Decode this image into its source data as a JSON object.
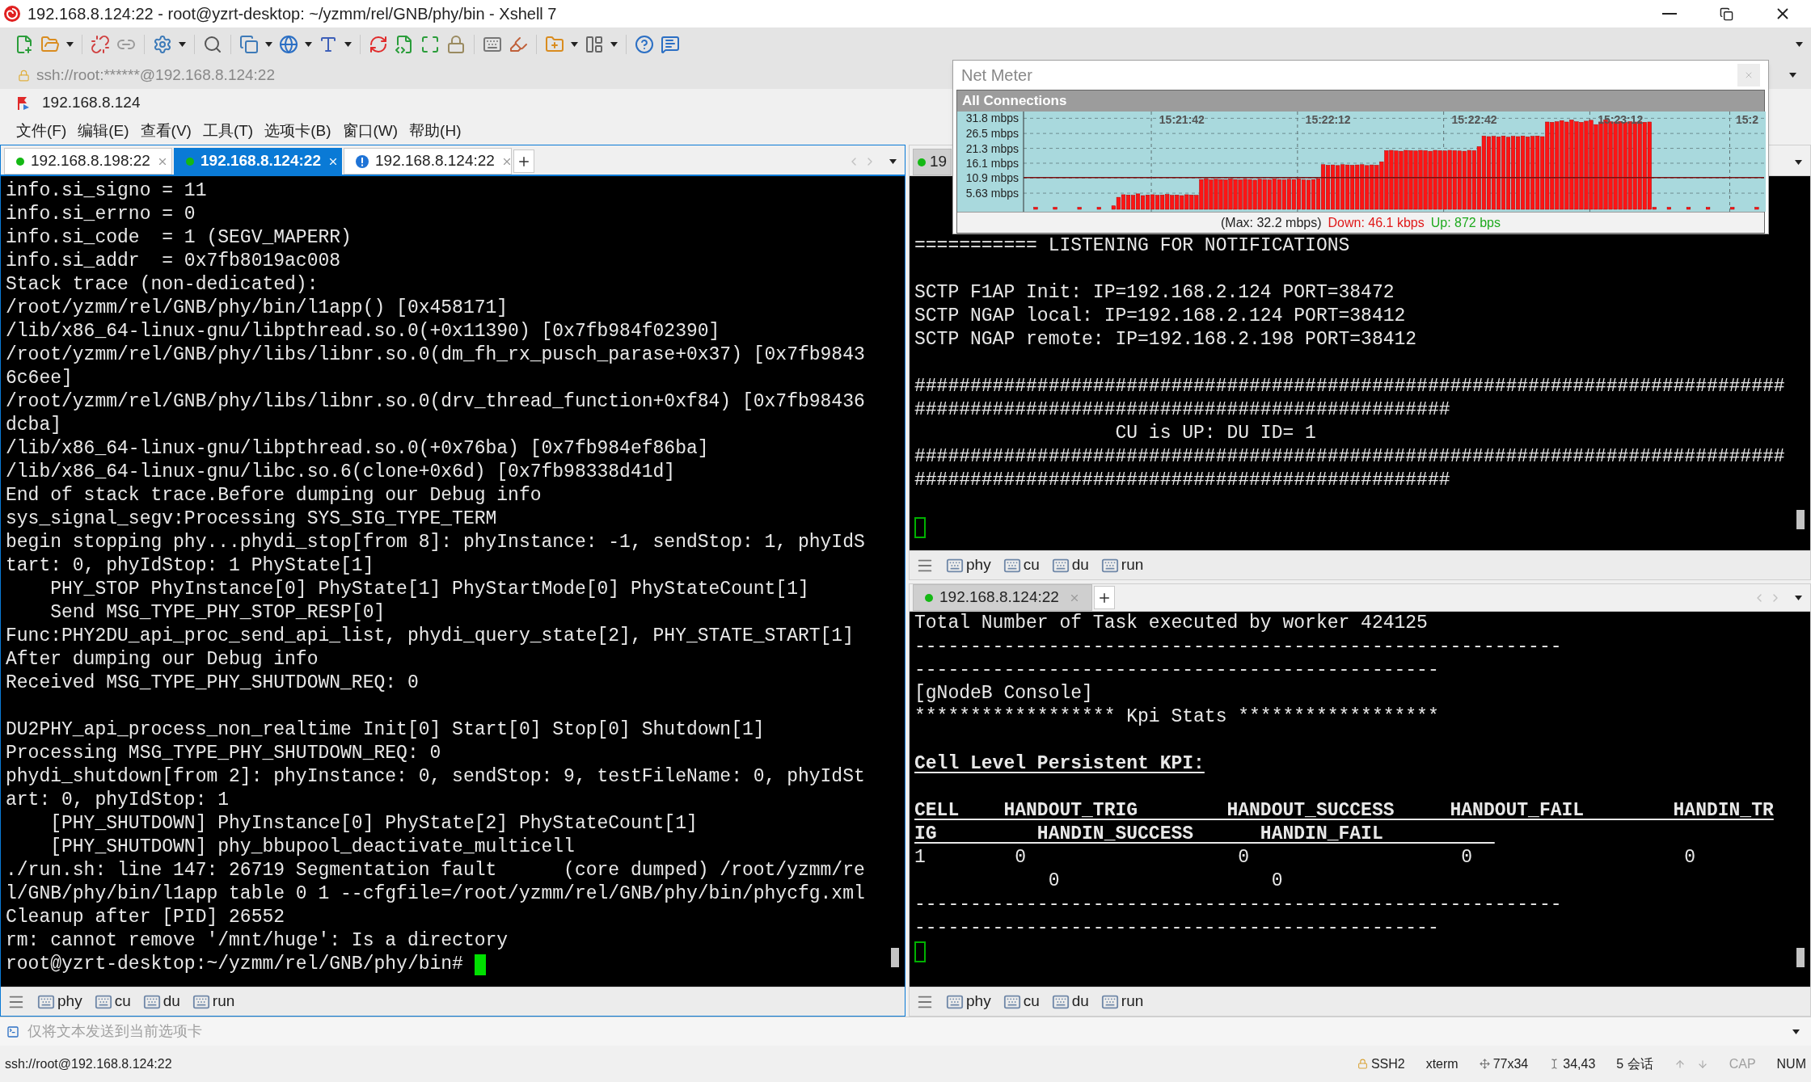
{
  "window": {
    "title": "192.168.8.124:22 - root@yzrt-desktop: ~/yzmm/rel/GNB/phy/bin - Xshell 7"
  },
  "address_bar": {
    "value": "ssh://root:******@192.168.8.124:22"
  },
  "session_bar": {
    "label": "192.168.8.124"
  },
  "menu": [
    "文件(F)",
    "编辑(E)",
    "查看(V)",
    "工具(T)",
    "选项卡(B)",
    "窗口(W)",
    "帮助(H)"
  ],
  "panes": [
    {
      "active": true,
      "tabs": [
        {
          "label": "192.168.8.198:22",
          "kind": "connected",
          "selected": false,
          "closable": true
        },
        {
          "label": "192.168.8.124:22",
          "kind": "connected",
          "selected": true,
          "closable": true
        },
        {
          "label": "192.168.8.124:22",
          "kind": "alert",
          "selected": false,
          "closable": true
        }
      ],
      "terminal": {
        "cursor_active": true,
        "prompt": "root@yzrt-desktop:~/yzmm/rel/GNB/phy/bin#",
        "lines": [
          {
            "kind": "text",
            "text": "info.si_signo = 11"
          },
          {
            "kind": "text",
            "text": "info.si_errno = 0"
          },
          {
            "kind": "text",
            "text": "info.si_code  = 1 (SEGV_MAPERR)"
          },
          {
            "kind": "text",
            "text": "info.si_addr  = 0x7fb8019ac008"
          },
          {
            "kind": "text",
            "text": "Stack trace (non-dedicated):"
          },
          {
            "kind": "text",
            "text": "/root/yzmm/rel/GNB/phy/bin/l1app() [0x458171]"
          },
          {
            "kind": "text",
            "text": "/lib/x86_64-linux-gnu/libpthread.so.0(+0x11390) [0x7fb984f02390]"
          },
          {
            "kind": "text",
            "text": "/root/yzmm/rel/GNB/phy/libs/libnr.so.0(dm_fh_rx_pusch_parase+0x37) [0x7fb9843"
          },
          {
            "kind": "text",
            "text": "6c6ee]"
          },
          {
            "kind": "text",
            "text": "/root/yzmm/rel/GNB/phy/libs/libnr.so.0(drv_thread_function+0xf84) [0x7fb98436"
          },
          {
            "kind": "text",
            "text": "dcba]"
          },
          {
            "kind": "text",
            "text": "/lib/x86_64-linux-gnu/libpthread.so.0(+0x76ba) [0x7fb984ef86ba]"
          },
          {
            "kind": "text",
            "text": "/lib/x86_64-linux-gnu/libc.so.6(clone+0x6d) [0x7fb98338d41d]"
          },
          {
            "kind": "text",
            "text": "End of stack trace.Before dumping our Debug info"
          },
          {
            "kind": "text",
            "text": "sys_signal_segv:Processing SYS_SIG_TYPE_TERM"
          },
          {
            "kind": "text",
            "text": "begin stopping phy...phydi_stop[from 8]: phyInstance: -1, sendStop: 1, phyIdS"
          },
          {
            "kind": "text",
            "text": "tart: 0, phyIdStop: 1 PhyState[1]"
          },
          {
            "kind": "text",
            "text": "    PHY_STOP PhyInstance[0] PhyState[1] PhyStartMode[0] PhyStateCount[1]"
          },
          {
            "kind": "text",
            "text": "    Send MSG_TYPE_PHY_STOP_RESP[0]"
          },
          {
            "kind": "text",
            "text": "Func:PHY2DU_api_proc_send_api_list, phydi_query_state[2], PHY_STATE_START[1]"
          },
          {
            "kind": "text",
            "text": "After dumping our Debug info"
          },
          {
            "kind": "text",
            "text": "Received MSG_TYPE_PHY_SHUTDOWN_REQ: 0"
          },
          {
            "kind": "blank"
          },
          {
            "kind": "text",
            "text": "DU2PHY_api_process_non_realtime Init[0] Start[0] Stop[0] Shutdown[1]"
          },
          {
            "kind": "text",
            "text": "Processing MSG_TYPE_PHY_SHUTDOWN_REQ: 0"
          },
          {
            "kind": "text",
            "text": "phydi_shutdown[from 2]: phyInstance: 0, sendStop: 9, testFileName: 0, phyIdSt"
          },
          {
            "kind": "text",
            "text": "art: 0, phyIdStop: 1"
          },
          {
            "kind": "text",
            "text": "    [PHY_SHUTDOWN] PhyInstance[0] PhyState[2] PhyStateCount[1]"
          },
          {
            "kind": "text",
            "text": "    [PHY_SHUTDOWN] phy_bbupool_deactivate_multicell"
          },
          {
            "kind": "text",
            "text": "./run.sh: line 147: 26719 Segmentation fault      (core dumped) /root/yzmm/re"
          },
          {
            "kind": "text",
            "text": "l/GNB/phy/bin/l1app table 0 1 --cfgfile=/root/yzmm/rel/GNB/phy/bin/phycfg.xml"
          },
          {
            "kind": "text",
            "text": "Cleanup after [PID] 26552"
          },
          {
            "kind": "text",
            "text": "rm: cannot remove '/mnt/huge': Is a directory"
          }
        ]
      },
      "quick_commands": [
        "phy",
        "cu",
        "du",
        "run"
      ]
    },
    {
      "active": false,
      "tabs": [
        {
          "label": "19",
          "kind": "connected",
          "selected": true,
          "closable": false
        }
      ],
      "terminal": {
        "cursor_active": false,
        "lines": [
          {
            "kind": "text",
            "text": "=========== LISTENING FOR NOTIFICATIONS"
          },
          {
            "kind": "blank"
          },
          {
            "kind": "text",
            "text": "SCTP F1AP Init: IP=192.168.2.124 PORT=38472"
          },
          {
            "kind": "text",
            "text": "SCTP NGAP local: IP=192.168.2.124 PORT=38412"
          },
          {
            "kind": "text",
            "text": "SCTP NGAP remote: IP=192.168.2.198 PORT=38412"
          },
          {
            "kind": "blank"
          },
          {
            "kind": "text",
            "text": "##############################################################################"
          },
          {
            "kind": "text",
            "text": "################################################"
          },
          {
            "kind": "text",
            "text": "                  CU is UP: DU ID= 1"
          },
          {
            "kind": "text",
            "text": "##############################################################################"
          },
          {
            "kind": "text",
            "text": "################################################"
          },
          {
            "kind": "blank"
          }
        ]
      },
      "quick_commands": [
        "phy",
        "cu",
        "du",
        "run"
      ]
    },
    {
      "active": false,
      "tabs": [
        {
          "label": "192.168.8.124:22",
          "kind": "connected",
          "selected": true,
          "closable": true
        }
      ],
      "terminal": {
        "cursor_active": false,
        "lines": [
          {
            "kind": "text",
            "text": "Total Number of Task executed by worker 424125"
          },
          {
            "kind": "text",
            "text": "----------------------------------------------------------"
          },
          {
            "kind": "text",
            "text": "-----------------------------------------------"
          },
          {
            "kind": "text",
            "text": "[gNodeB Console]"
          },
          {
            "kind": "text",
            "text": "****************** Kpi Stats ******************"
          },
          {
            "kind": "blank"
          },
          {
            "kind": "heading",
            "text": "Cell Level Persistent KPI:"
          },
          {
            "kind": "blank"
          },
          {
            "kind": "heading",
            "text": "CELL    HANDOUT_TRIG        HANDOUT_SUCCESS     HANDOUT_FAIL        HANDIN_TR"
          },
          {
            "kind": "heading",
            "text": "IG         HANDIN_SUCCESS      HANDIN_FAIL          "
          },
          {
            "kind": "text",
            "text": "1        0                   0                   0                   0"
          },
          {
            "kind": "text",
            "text": "            0                   0"
          },
          {
            "kind": "text",
            "text": "----------------------------------------------------------"
          },
          {
            "kind": "text",
            "text": "-----------------------------------------------"
          }
        ]
      },
      "quick_commands": [
        "phy",
        "cu",
        "du",
        "run"
      ]
    }
  ],
  "net_meter": {
    "title": "Net Meter",
    "chart_data": {
      "type": "bar",
      "title": "All Connections",
      "ylim": [
        0,
        33.6
      ],
      "grid": true,
      "yticks": [
        {
          "value": 5.63,
          "label": "5.63 mbps"
        },
        {
          "value": 10.9,
          "label": "10.9 mbps"
        },
        {
          "value": 16.1,
          "label": "16.1 mbps"
        },
        {
          "value": 21.3,
          "label": "21.3 mbps"
        },
        {
          "value": 26.5,
          "label": "26.5 mbps"
        },
        {
          "value": 31.8,
          "label": "31.8 mbps"
        }
      ],
      "ref_lines": [
        {
          "axis": "y",
          "value": 11.1
        }
      ],
      "categories": [
        null,
        null,
        null,
        null,
        null,
        null,
        null,
        null,
        null,
        null,
        null,
        null,
        null,
        null,
        null,
        null,
        null,
        null,
        null,
        null,
        null,
        null,
        null,
        null,
        null,
        null,
        null,
        null,
        null,
        null,
        null,
        null,
        "15:21:42",
        null,
        null,
        null,
        null,
        null,
        null,
        null,
        null,
        null,
        null,
        null,
        null,
        null,
        null,
        null,
        null,
        null,
        null,
        null,
        null,
        null,
        null,
        null,
        null,
        null,
        null,
        null,
        null,
        null,
        "15:22:12",
        null,
        null,
        null,
        null,
        null,
        null,
        null,
        null,
        null,
        null,
        null,
        null,
        null,
        null,
        null,
        null,
        null,
        null,
        null,
        null,
        null,
        null,
        null,
        null,
        null,
        null,
        null,
        null,
        null,
        "15:22:42",
        null,
        null,
        null,
        null,
        null,
        null,
        null,
        null,
        null,
        null,
        null,
        null,
        null,
        null,
        null,
        null,
        null,
        null,
        null,
        null,
        null,
        null,
        null,
        null,
        null,
        null,
        null,
        null,
        null,
        "15:23:12",
        null,
        null,
        null,
        null,
        null,
        null,
        null,
        null,
        null,
        null,
        null,
        null,
        null,
        null,
        null,
        null,
        null,
        null,
        null,
        null,
        null,
        null,
        null,
        null,
        null,
        "15:2",
        null,
        null,
        null
      ],
      "values": [
        null,
        null,
        0.7,
        null,
        null,
        null,
        0.7,
        null,
        null,
        null,
        null,
        0.7,
        null,
        null,
        null,
        0.7,
        null,
        null,
        1.2,
        4.2,
        5.1,
        5.0,
        4.9,
        5.4,
        4.8,
        5.0,
        5.1,
        4.9,
        5.0,
        5.2,
        4.9,
        5.0,
        4.8,
        5.1,
        5.0,
        4.9,
        10.4,
        10.6,
        10.3,
        10.5,
        10.4,
        10.3,
        10.6,
        10.4,
        10.3,
        10.5,
        10.4,
        10.2,
        10.5,
        10.4,
        10.3,
        10.6,
        10.4,
        10.3,
        10.5,
        10.4,
        10.6,
        10.3,
        10.2,
        10.4,
        10.7,
        15.6,
        15.4,
        15.5,
        15.3,
        15.6,
        15.5,
        15.4,
        15.5,
        15.6,
        15.3,
        15.5,
        15.4,
        16.6,
        20.5,
        20.6,
        20.4,
        20.3,
        20.6,
        20.5,
        20.4,
        20.6,
        20.5,
        20.3,
        20.6,
        20.5,
        20.4,
        20.6,
        20.5,
        20.4,
        20.3,
        20.6,
        20.5,
        21.9,
        25.6,
        25.4,
        25.5,
        25.3,
        25.6,
        25.2,
        25.5,
        25.4,
        25.6,
        25.3,
        25.5,
        25.6,
        25.4,
        30.5,
        30.4,
        30.6,
        31.0,
        30.5,
        31.2,
        30.6,
        30.4,
        30.8,
        31.1,
        29.6,
        30.5,
        31.2,
        30.6,
        30.5,
        30.7,
        30.4,
        30.6,
        30.5,
        30.6,
        30.4,
        30.5,
        0.7,
        null,
        null,
        0.7,
        null,
        null,
        null,
        0.7,
        null,
        null,
        null,
        0.7,
        null,
        null,
        null,
        null,
        0.7,
        null,
        null,
        null,
        null,
        0.7,
        null
      ]
    },
    "max": "(Max: 32.2 mbps)",
    "down": "Down: 46.1 kbps",
    "up": "Up: 872 bps"
  },
  "compose_bar": {
    "placeholder": "仅将文本发送到当前选项卡"
  },
  "status_bar": {
    "connection": "ssh://root@192.168.8.124:22",
    "right": [
      {
        "kind": "protocol",
        "text": "SSH2"
      },
      {
        "kind": "plain",
        "text": "xterm"
      },
      {
        "kind": "size",
        "text": "77x34"
      },
      {
        "kind": "position",
        "text": "34,43"
      },
      {
        "kind": "plain",
        "text": "5 会话"
      },
      {
        "kind": "arrows"
      },
      {
        "kind": "key",
        "text": "CAP",
        "disabled": true
      },
      {
        "kind": "key",
        "text": "NUM",
        "disabled": false
      }
    ]
  }
}
